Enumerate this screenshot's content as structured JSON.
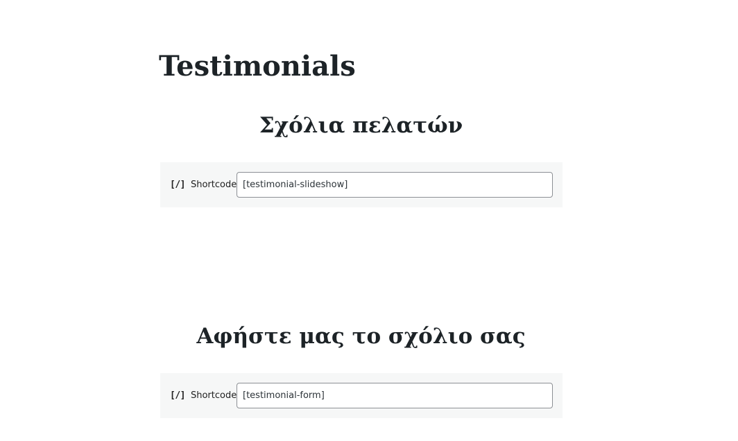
{
  "page": {
    "title": "Testimonials"
  },
  "sections": [
    {
      "heading": "Σχόλια πελατών",
      "shortcode": {
        "icon": "[/]",
        "label": "Shortcode",
        "value": "[testimonial-slideshow]"
      }
    },
    {
      "heading": "Αφήστε μας το σχόλιο σας",
      "shortcode": {
        "icon": "[/]",
        "label": "Shortcode",
        "value": "[testimonial-form]"
      }
    }
  ]
}
